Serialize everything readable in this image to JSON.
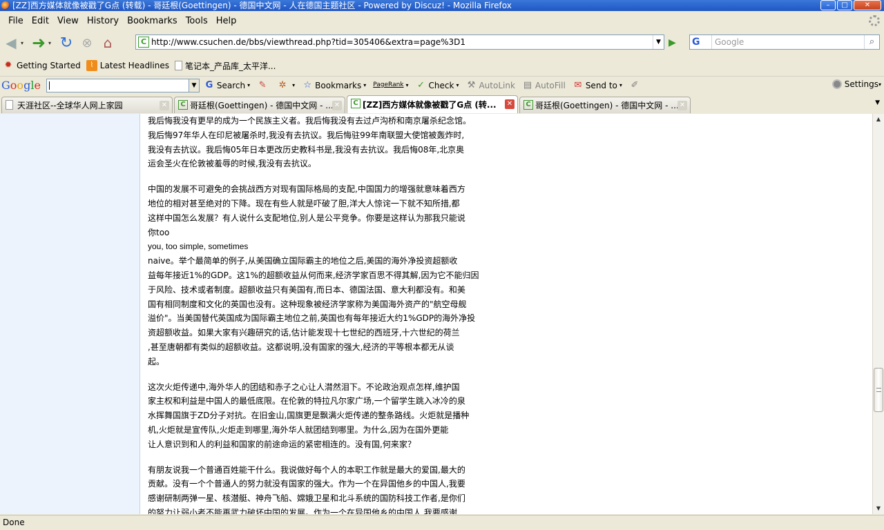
{
  "window": {
    "title": "[ZZ]西方媒体就像被戳了G点 (转载) - 哥廷根(Goettingen) - 德国中文网 - 人在德国主题社区 - Powered by Discuz! - Mozilla Firefox",
    "buttons": {
      "minimize": "–",
      "maximize": "□",
      "close": "✕"
    }
  },
  "menubar": {
    "items": [
      "File",
      "Edit",
      "View",
      "History",
      "Bookmarks",
      "Tools",
      "Help"
    ]
  },
  "navbar": {
    "url": "http://www.csuchen.de/bbs/viewthread.php?tid=305406&extra=page%3D1",
    "search_engine": "G",
    "search_placeholder": "Google"
  },
  "bookmarks": {
    "items": [
      "Getting Started",
      "Latest Headlines",
      "笔记本_产品库_太平洋..."
    ]
  },
  "google_toolbar": {
    "logo": [
      "G",
      "o",
      "o",
      "g",
      "l",
      "e"
    ],
    "search_label": "Search",
    "bookmarks_label": "Bookmarks",
    "pagerank_label": "PageRank",
    "check_label": "Check",
    "autolink_label": "AutoLink",
    "autofill_label": "AutoFill",
    "sendto_label": "Send to",
    "settings_label": "Settings"
  },
  "tabs": [
    {
      "label": "天涯社区--全球华人网上家园",
      "active": false
    },
    {
      "label": "哥廷根(Goettingen) - 德国中文网 - ...",
      "active": false
    },
    {
      "label": "[ZZ]西方媒体就像被戳了G点 (转...",
      "active": true
    },
    {
      "label": "哥廷根(Goettingen) - 德国中文网 - ...",
      "active": false
    }
  ],
  "post": {
    "p1": [
      "我后悔我没有更早的成为一个民族主义者。我后悔我没有去过卢沟桥和南京屠杀纪念馆。",
      "我后悔97年华人在印尼被屠杀时,我没有去抗议。我后悔驻99年南联盟大使馆被轰炸时,",
      "我没有去抗议。我后悔05年日本更改历史教科书是,我没有去抗议。我后悔08年,北京奥",
      "运会圣火在伦敦被羞辱的时候,我没有去抗议。"
    ],
    "p2": [
      "中国的发展不可避免的会挑战西方对现有国际格局的支配,中国国力的增强就意味着西方",
      "地位的相对甚至绝对的下降。现在有些人就是吓破了胆,洋大人惊诧一下就不知所措,都",
      "这样中国怎么发展？有人说什么支配地位,别人是公平竞争。你要是这样认为那我只能说",
      "你too",
      "you, too simple, sometimes",
      "naive。举个最简单的例子,从美国确立国际霸主的地位之后,美国的海外净投资超额收",
      "益每年接近1%的GDP。这1%的超额收益从何而来,经济学家百思不得其解,因为它不能归因",
      "于风险、技术或者制度。超额收益只有美国有,而日本、德国法国、意大利都没有。和美",
      "国有相同制度和文化的英国也没有。这种现象被经济学家称为美国海外资产的\"航空母舰",
      "溢价\"。当美国替代英国成为国际霸主地位之前,英国也有每年接近大约1%GDP的海外净投",
      "资超额收益。如果大家有兴趣研究的话,估计能发现十七世纪的西班牙,十六世纪的荷兰",
      ",甚至唐朝都有类似的超额收益。这都说明,没有国家的强大,经济的平等根本都无从谈",
      "起。"
    ],
    "p3": [
      "这次火炬传递中,海外华人的团结和赤子之心让人潸然泪下。不论政治观点怎样,维护国",
      "家主权和利益是中国人的最低底限。在伦敦的特拉凡尔家广场,一个留学生跳入冰冷的泉",
      "水挥舞国旗于ZD分子对抗。在旧金山,国旗更是飘满火炬传递的整条路线。火炬就是播种",
      "机,火炬就是宣传队,火炬走到哪里,海外华人就团结到哪里。为什么,因为在国外更能",
      "让人意识到和人的利益和国家的前途命运的紧密相连的。没有国,何来家？"
    ],
    "p4": [
      "有朋友说我一个普通百姓能干什么。我说做好每个人的本职工作就是最大的爱国,最大的",
      "贡献。没有一个个普通人的努力就没有国家的强大。作为一个在异国他乡的中国人,我要",
      "感谢研制两弹一星、核潜艇、神舟飞船、嫦娥卫星和北斗系统的国防科技工作者,是你们",
      "的努力让弱小者不能再武力破坏中国的发展。作为一个在异国他乡的中国人,我要感谢"
    ]
  },
  "status": {
    "text": "Done"
  }
}
